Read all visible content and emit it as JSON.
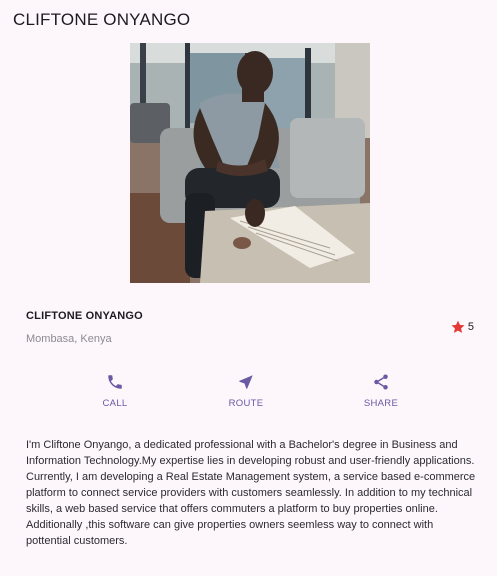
{
  "app_bar": {
    "title": "CLIFTONE ONYANGO"
  },
  "profile": {
    "photo_icon": "profile-photo",
    "name": "CLIFTONE ONYANGO",
    "location": "Mombasa, Kenya",
    "rating": {
      "icon": "star-icon",
      "value": "5",
      "color": "#e53935"
    }
  },
  "actions": [
    {
      "icon": "phone-icon",
      "label": "CALL"
    },
    {
      "icon": "navigation-icon",
      "label": "ROUTE"
    },
    {
      "icon": "share-icon",
      "label": "SHARE"
    }
  ],
  "bio": "I'm Cliftone Onyango, a dedicated professional with a Bachelor's degree in Business and Information Technology.My expertise lies in developing robust and user-friendly applications. Currently, I am developing a Real Estate Management system, a service based e-commerce platform to connect service providers with customers seamlessly. In addition to my technical skills, a web based service that offers commuters a platform to buy properties online. Additionally ,this software can give properties owners seemless way to connect with pottential customers.",
  "colors": {
    "background": "#fdf7fc",
    "accent": "#6a5aa3",
    "text": "#1d1b20",
    "secondary_text": "#8d8a90"
  }
}
